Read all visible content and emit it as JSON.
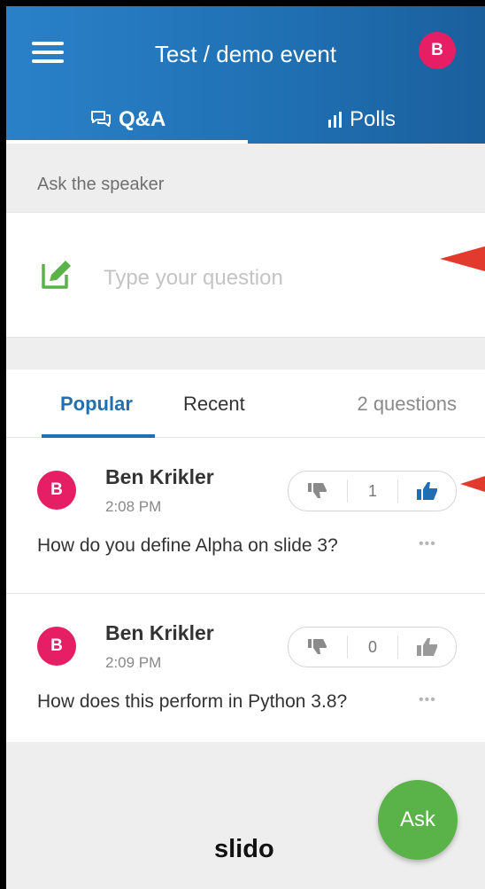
{
  "header": {
    "title": "Test / demo event",
    "avatar_initial": "B",
    "tabs": [
      {
        "label": "Q&A",
        "icon": "chat-bubbles-icon"
      },
      {
        "label": "Polls",
        "icon": "bar-chart-icon"
      }
    ]
  },
  "ask": {
    "label": "Ask the speaker",
    "placeholder": "Type your question",
    "icon": "edit-icon"
  },
  "list": {
    "tab_popular": "Popular",
    "tab_recent": "Recent",
    "count": "2 questions",
    "questions": [
      {
        "initial": "B",
        "author": "Ben Krikler",
        "time": "2:08 PM",
        "text": "How do you define Alpha on slide 3?",
        "votes": "1",
        "liked": true,
        "more": "•••"
      },
      {
        "initial": "B",
        "author": "Ben Krikler",
        "time": "2:09 PM",
        "text": "How does this perform in Python 3.8?",
        "votes": "0",
        "liked": false,
        "more": "•••"
      }
    ]
  },
  "footer": {
    "brand": "slido",
    "ask_button": "Ask"
  },
  "colors": {
    "brand_blue": "#1f6fb2",
    "avatar": "#e61e64",
    "accent_green": "#5ab348",
    "annotation_arrow": "#e23b2e"
  }
}
